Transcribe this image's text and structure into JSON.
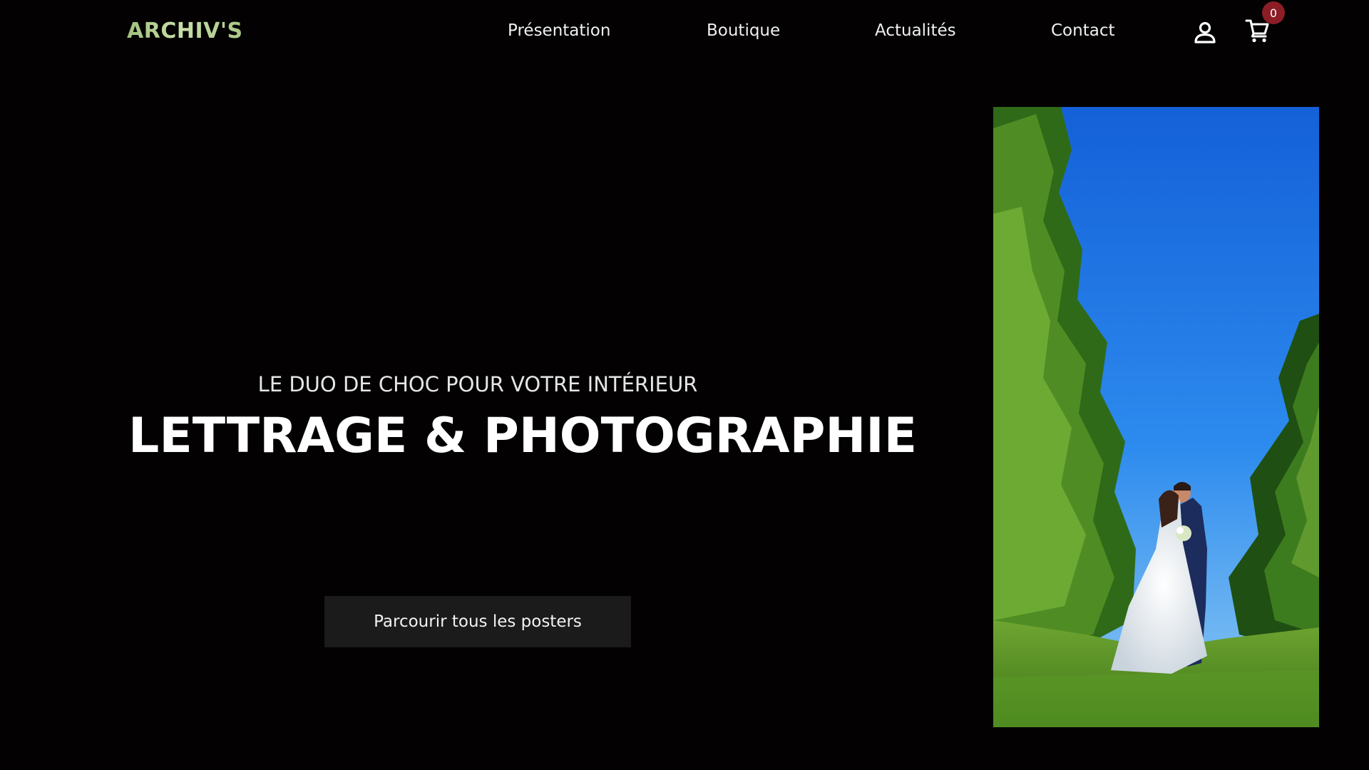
{
  "header": {
    "logo_text": "ARCHIV'S",
    "nav": {
      "presentation": "Présentation",
      "boutique": "Boutique",
      "actualites": "Actualités",
      "contact": "Contact"
    },
    "cart_count": "0",
    "icons": {
      "account": "account-icon",
      "cart": "cart-icon"
    }
  },
  "hero": {
    "subtitle": "LE DUO DE CHOC POUR VOTRE INTÉRIEUR",
    "title": "LETTRAGE & PHOTOGRAPHIE",
    "cta_label": "Parcourir tous les posters"
  },
  "colors": {
    "background": "#030102",
    "logo_green": "#b5d190",
    "badge": "#8c1d25",
    "button_bg": "#1c1b1c",
    "sky": "#2277e0",
    "foliage": "#3f7a1e"
  }
}
